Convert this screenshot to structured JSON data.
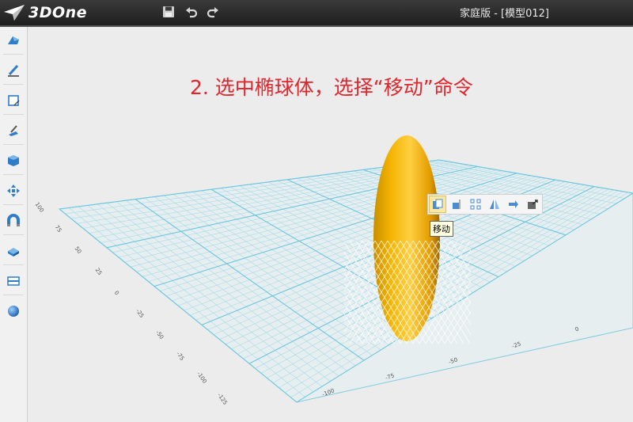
{
  "app": {
    "logo_text": "3DOne",
    "window_title": "家庭版 - [模型012]"
  },
  "toolbar": {
    "items": [
      {
        "name": "save-icon"
      },
      {
        "name": "undo-icon"
      },
      {
        "name": "redo-icon"
      }
    ]
  },
  "left_toolbar": {
    "items": [
      "basic-solid-icon",
      "sketch-pencil-icon",
      "sketch-edit-icon",
      "feature-modify-icon",
      "special-function-icon",
      "basic-edit-icon",
      "magnet-icon",
      "combine-icon",
      "panel-icon",
      "material-sphere-icon"
    ]
  },
  "instruction": "2. 选中椭球体，选择“移动”命令",
  "mini_toolbar": {
    "items": [
      "move-icon",
      "align-icon",
      "array-icon",
      "mirror-icon",
      "dr-icon",
      "export-icon"
    ],
    "active_index": 0
  },
  "tooltip": "移动",
  "grid_labels": {
    "left_axis": [
      "100",
      "75",
      "50",
      "25",
      "0",
      "-25",
      "-50",
      "-75",
      "-100",
      "-125"
    ],
    "bottom_axis": [
      "-100",
      "-75",
      "-50",
      "-25",
      "0"
    ]
  },
  "colors": {
    "instruction": "#e0262c",
    "ellipsoid": "#f2b000",
    "grid": "#6cc6e0"
  }
}
